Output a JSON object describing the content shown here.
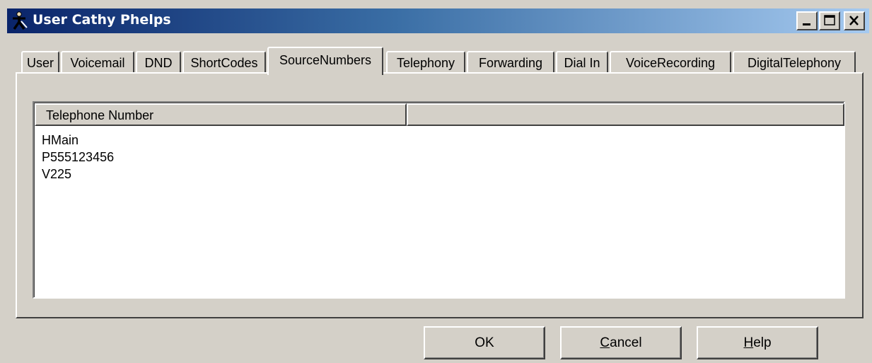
{
  "window": {
    "title": "User Cathy Phelps",
    "icon": "user-figure-icon"
  },
  "titlebar_buttons": {
    "minimize": "minimize-icon",
    "maximize": "maximize-icon",
    "close": "close-icon"
  },
  "tabs": [
    {
      "label": "User"
    },
    {
      "label": "Voicemail"
    },
    {
      "label": "DND"
    },
    {
      "label": "ShortCodes"
    },
    {
      "label": "SourceNumbers",
      "active": true
    },
    {
      "label": "Telephony"
    },
    {
      "label": "Forwarding"
    },
    {
      "label": "Dial In"
    },
    {
      "label": "VoiceRecording"
    },
    {
      "label": "DigitalTelephony"
    }
  ],
  "list": {
    "columns": [
      "Telephone Number",
      ""
    ],
    "rows": [
      "HMain",
      "P555123456",
      "V225"
    ]
  },
  "buttons": {
    "ok": {
      "label": "OK"
    },
    "cancel": {
      "accel": "C",
      "rest": "ancel"
    },
    "help": {
      "accel": "H",
      "rest": "elp"
    }
  },
  "colors": {
    "face": "#d4d0c8",
    "title_start": "#0a246a",
    "title_end": "#a6caf0"
  }
}
